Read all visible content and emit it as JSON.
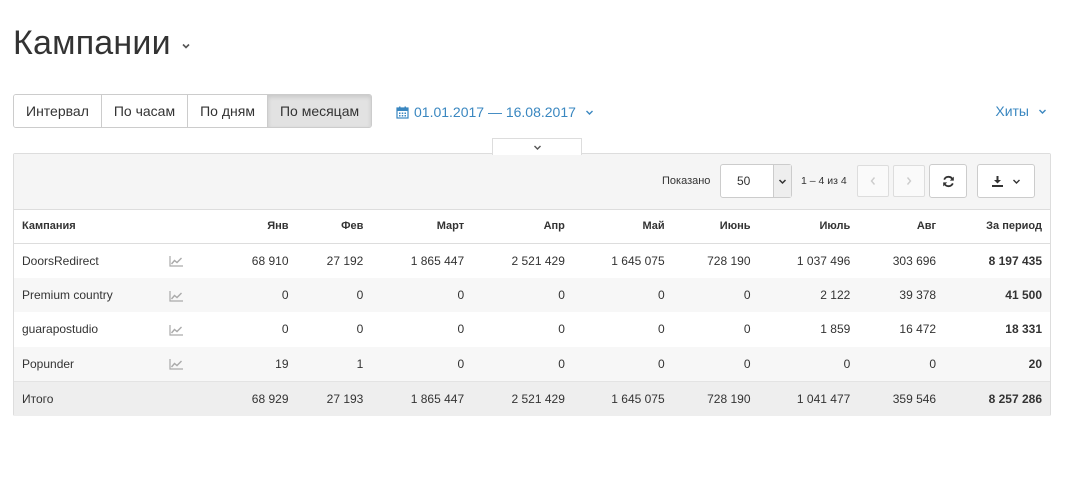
{
  "page": {
    "title": "Кампании"
  },
  "interval_buttons": [
    "Интервал",
    "По часам",
    "По дням",
    "По месяцам"
  ],
  "date_range": {
    "label": "01.01.2017 — 16.08.2017"
  },
  "metric_selector": {
    "label": "Хиты"
  },
  "toolbar": {
    "shown_label": "Показано",
    "per_page_value": "50",
    "range_text": "1 – 4 из 4"
  },
  "table": {
    "headers": [
      "Кампания",
      "",
      "Янв",
      "Фев",
      "Март",
      "Апр",
      "Май",
      "Июнь",
      "Июль",
      "Авг",
      "За период"
    ],
    "rows": [
      {
        "name": "DoorsRedirect",
        "values": [
          "68 910",
          "27 192",
          "1 865 447",
          "2 521 429",
          "1 645 075",
          "728 190",
          "1 037 496",
          "303 696"
        ],
        "total": "8 197 435"
      },
      {
        "name": "Premium country",
        "values": [
          "0",
          "0",
          "0",
          "0",
          "0",
          "0",
          "2 122",
          "39 378"
        ],
        "total": "41 500"
      },
      {
        "name": "guarapostudio",
        "values": [
          "0",
          "0",
          "0",
          "0",
          "0",
          "0",
          "1 859",
          "16 472"
        ],
        "total": "18 331"
      },
      {
        "name": "Popunder",
        "values": [
          "19",
          "1",
          "0",
          "0",
          "0",
          "0",
          "0",
          "0"
        ],
        "total": "20"
      }
    ],
    "footer": {
      "name": "Итого",
      "values": [
        "68 929",
        "27 193",
        "1 865 447",
        "2 521 429",
        "1 645 075",
        "728 190",
        "1 041 477",
        "359 546"
      ],
      "total": "8 257 286"
    }
  },
  "icons": {
    "title_caret": "caret-down-icon",
    "date": "calendar-icon",
    "row_chart": "line-chart-icon",
    "refresh": "refresh-icon",
    "download": "download-icon"
  },
  "colors": {
    "link": "#3a87c0",
    "active_segment": "#e2e2e2",
    "stripe": "#f7f7f7",
    "footer": "#eeeeee"
  }
}
